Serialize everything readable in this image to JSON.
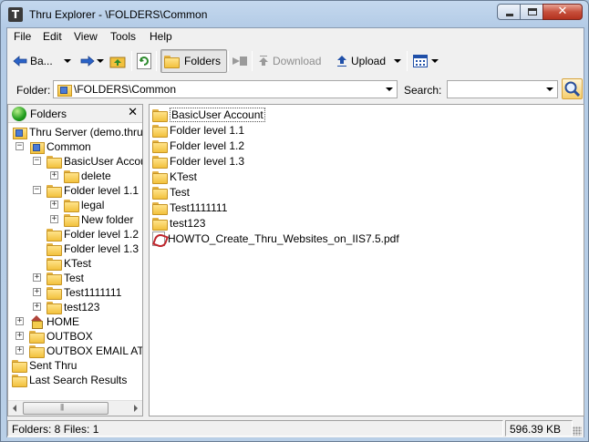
{
  "window": {
    "title": "Thru Explorer - \\FOLDERS\\Common",
    "app_icon_letter": "T"
  },
  "menu": [
    "File",
    "Edit",
    "View",
    "Tools",
    "Help"
  ],
  "toolbar": {
    "back_label": "Ba...",
    "folders_label": "Folders",
    "download_label": "Download",
    "upload_label": "Upload"
  },
  "address": {
    "folder_label": "Folder:",
    "folder_value": "\\FOLDERS\\Common",
    "search_label": "Search:",
    "search_value": ""
  },
  "left_pane": {
    "title": "Folders",
    "close_glyph": "✕",
    "tree": [
      {
        "label": "Thru Server (demo.thruinc",
        "icon": "server-icon",
        "expander": ""
      },
      {
        "label": "Common",
        "icon": "server-icon",
        "expander": "−"
      },
      {
        "label": "BasicUser Accoun",
        "icon": "folder-icon",
        "expander": "−"
      },
      {
        "label": "delete",
        "icon": "folder-icon",
        "expander": "+"
      },
      {
        "label": "Folder level 1.1",
        "icon": "folder-icon",
        "expander": "−"
      },
      {
        "label": "legal",
        "icon": "folder-icon",
        "expander": "+"
      },
      {
        "label": "New folder",
        "icon": "folder-icon",
        "expander": "+"
      },
      {
        "label": "Folder level 1.2",
        "icon": "folder-icon",
        "expander": ""
      },
      {
        "label": "Folder level 1.3",
        "icon": "folder-icon",
        "expander": ""
      },
      {
        "label": "KTest",
        "icon": "folder-icon",
        "expander": ""
      },
      {
        "label": "Test",
        "icon": "folder-icon",
        "expander": "+"
      },
      {
        "label": "Test1111111",
        "icon": "folder-icon",
        "expander": "+"
      },
      {
        "label": "test123",
        "icon": "folder-icon",
        "expander": "+"
      },
      {
        "label": "HOME",
        "icon": "home-icon",
        "expander": "+"
      },
      {
        "label": "OUTBOX",
        "icon": "folder-icon",
        "expander": "+"
      },
      {
        "label": "OUTBOX EMAIL ATT",
        "icon": "folder-icon",
        "expander": "+"
      },
      {
        "label": "Sent Thru",
        "icon": "folder-icon",
        "expander": ""
      },
      {
        "label": "Last Search Results",
        "icon": "folder-icon",
        "expander": ""
      }
    ]
  },
  "files": [
    {
      "name": "BasicUser Account",
      "type": "folder"
    },
    {
      "name": "Folder level 1.1",
      "type": "folder"
    },
    {
      "name": "Folder level 1.2",
      "type": "folder"
    },
    {
      "name": "Folder level 1.3",
      "type": "folder"
    },
    {
      "name": "KTest",
      "type": "folder"
    },
    {
      "name": "Test",
      "type": "folder"
    },
    {
      "name": "Test1111111",
      "type": "folder"
    },
    {
      "name": "test123",
      "type": "folder"
    },
    {
      "name": "HOWTO_Create_Thru_Websites_on_IIS7.5.pdf",
      "type": "pdf"
    }
  ],
  "status": {
    "summary": "Folders: 8 Files: 1",
    "size": "596.39 KB"
  }
}
